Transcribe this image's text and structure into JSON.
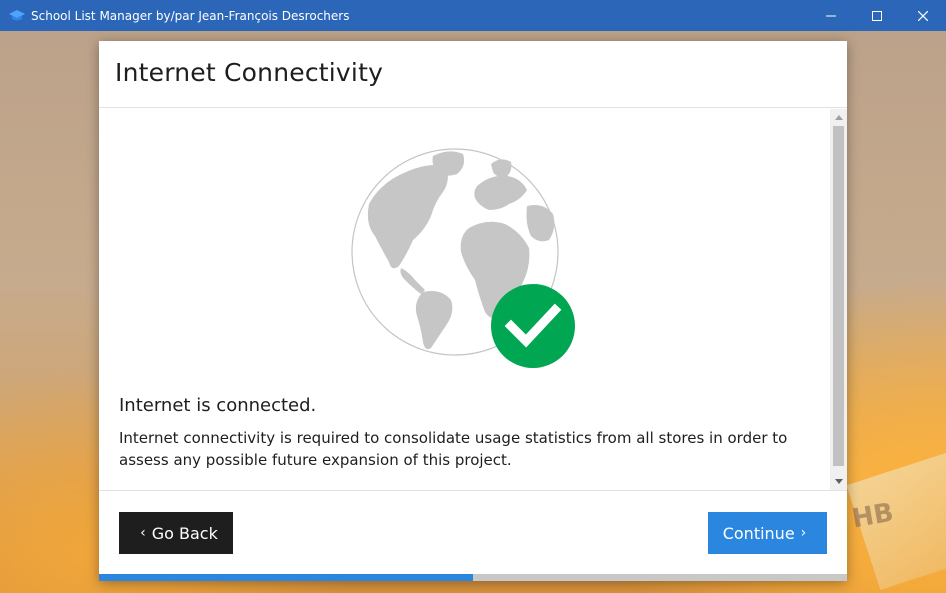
{
  "window": {
    "title": "School List Manager by/par Jean-François Desrochers",
    "controls": [
      "minimize",
      "maximize",
      "close"
    ]
  },
  "dialog": {
    "title": "Internet Connectivity",
    "illustration": {
      "globe_icon": "globe-icon",
      "status_icon": "check-circle-icon",
      "status_color": "#00a651"
    },
    "status_heading": "Internet is connected.",
    "status_text": "Internet connectivity is required to consolidate usage statistics from all stores in order to assess any possible future expansion of this project.",
    "buttons": {
      "back_label": "Go Back",
      "continue_label": "Continue"
    },
    "progress": 0.5
  },
  "colors": {
    "titlebar": "#2b66b8",
    "accent": "#2b86e0",
    "back_button": "#1e1e1e",
    "success": "#00a651"
  }
}
